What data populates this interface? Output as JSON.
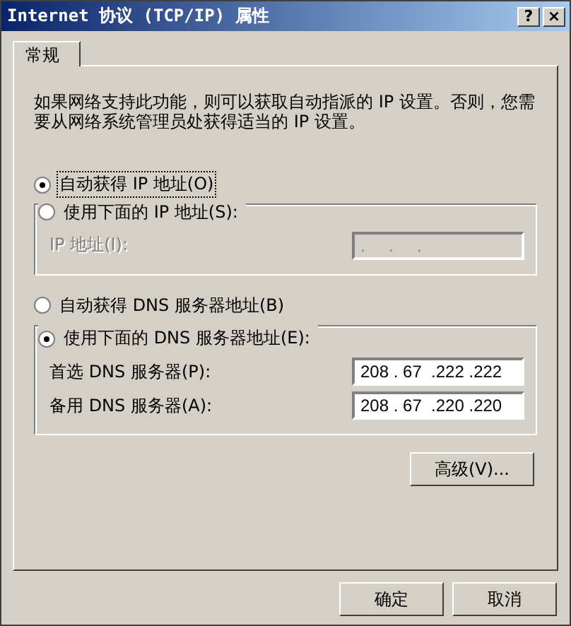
{
  "window": {
    "title": "Internet 协议 (TCP/IP) 属性",
    "help_button": "?",
    "close_button": "×"
  },
  "tabs": [
    {
      "label": "常规",
      "selected": true
    }
  ],
  "description": "如果网络支持此功能，则可以获取自动指派的 IP 设置。否则，您需要从网络系统管理员处获得适当的 IP 设置。",
  "ip_group": {
    "auto_option": {
      "label": "自动获得 IP 地址(O)",
      "selected": true,
      "focused": true
    },
    "manual_option": {
      "label": "使用下面的 IP 地址(S):",
      "selected": false
    },
    "fields": [
      {
        "label": "IP 地址(I):",
        "value": ".     .     .",
        "disabled": true
      }
    ]
  },
  "dns_group": {
    "auto_option": {
      "label": "自动获得 DNS 服务器地址(B)",
      "selected": false,
      "focused": false
    },
    "manual_option": {
      "label": "使用下面的 DNS 服务器地址(E):",
      "selected": true
    },
    "fields": [
      {
        "label": "首选 DNS 服务器(P):",
        "value": "208 . 67  .222 .222",
        "disabled": false
      },
      {
        "label": "备用 DNS 服务器(A):",
        "value": "208 . 67  .220 .220",
        "disabled": false
      }
    ]
  },
  "advanced_button": "高级(V)...",
  "buttons": [
    "确定",
    "取消"
  ]
}
